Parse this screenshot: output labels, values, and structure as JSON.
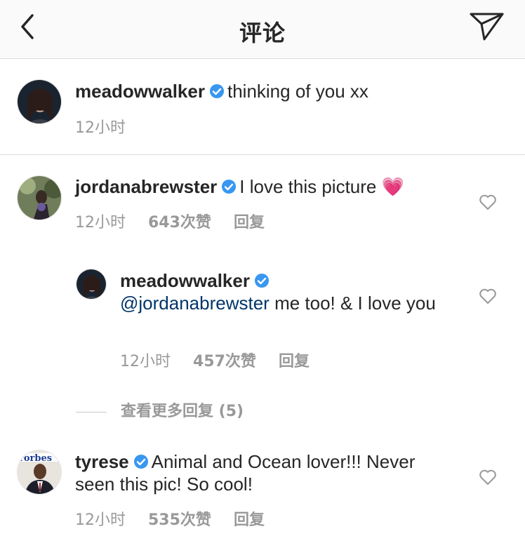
{
  "header": {
    "title": "评论"
  },
  "caption": {
    "username": "meadowwalker",
    "text": "thinking of you xx",
    "time": "12小时"
  },
  "comments": [
    {
      "username": "jordanabrewster",
      "text": "I love this picture",
      "emoji": "💗",
      "time": "12小时",
      "likes": "643次赞",
      "reply_label": "回复"
    },
    {
      "username": "meadowwalker",
      "mention": "@jordanabrewster",
      "text": "me too! & I love you",
      "time": "12小时",
      "likes": "457次赞",
      "reply_label": "回复"
    },
    {
      "username": "tyrese",
      "text": "Animal and Ocean lover!!! Never seen this pic! So cool!",
      "time": "12小时",
      "likes": "535次赞",
      "reply_label": "回复"
    }
  ],
  "more_replies": "查看更多回复 (5)",
  "colors": {
    "verified": "#3897f0",
    "mention": "#003569",
    "meta": "#999999",
    "divider": "#dbdbdb"
  },
  "icons": [
    "back-arrow-icon",
    "send-icon",
    "verified-badge-icon",
    "heart-icon"
  ]
}
